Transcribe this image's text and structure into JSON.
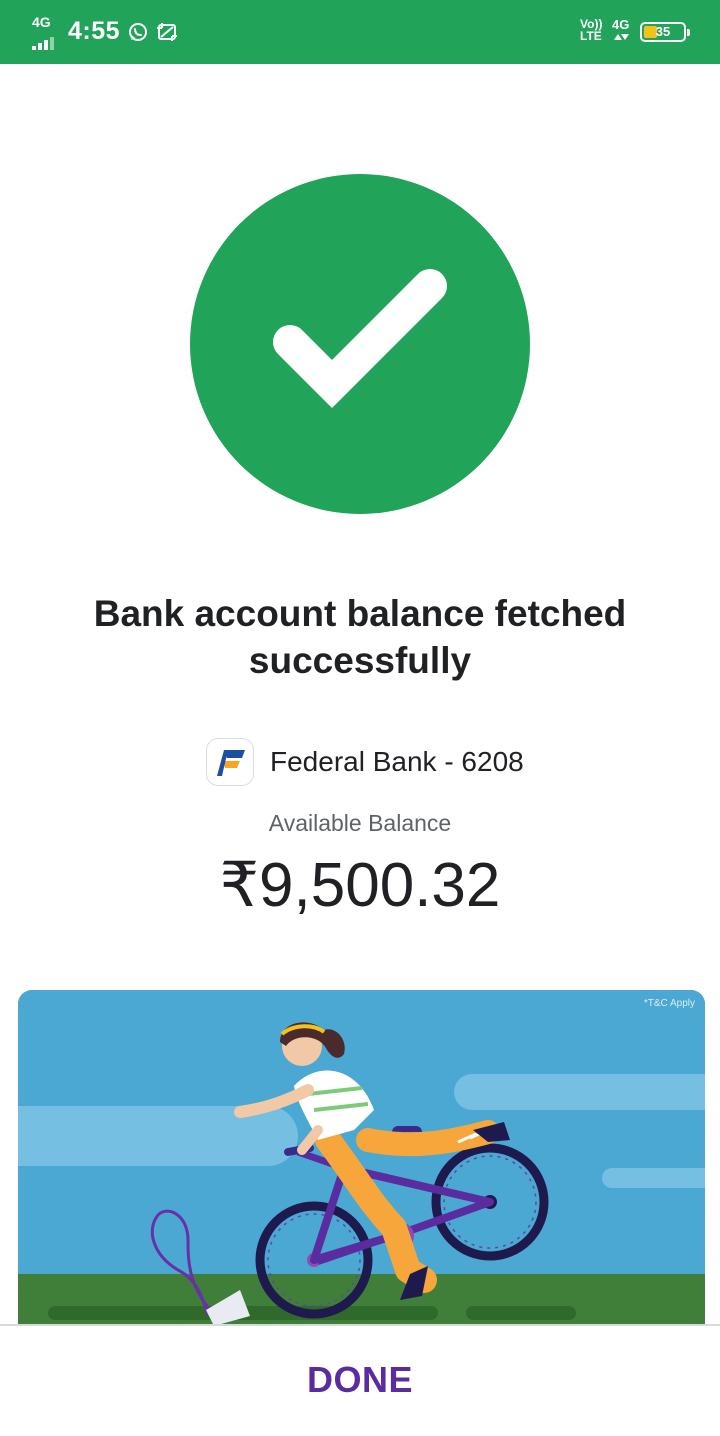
{
  "status_bar": {
    "network_left": "4G",
    "time": "4:55",
    "volte_line1": "Vo))",
    "volte_line2": "LTE",
    "network_right": "4G",
    "battery_percent": "35",
    "battery_level": 0.35
  },
  "colors": {
    "brand_green": "#22a35a",
    "done_purple": "#5a2ca0",
    "battery_yellow": "#f5c21b"
  },
  "success": {
    "icon": "checkmark-icon",
    "headline": "Bank account balance fetched successfully"
  },
  "account": {
    "bank_logo": "federal-bank-logo",
    "name": "Federal Bank - 6208",
    "balance_label": "Available Balance",
    "balance": "₹9,500.32"
  },
  "promo": {
    "terms": "*T&C Apply"
  },
  "footer": {
    "done_label": "DONE"
  }
}
